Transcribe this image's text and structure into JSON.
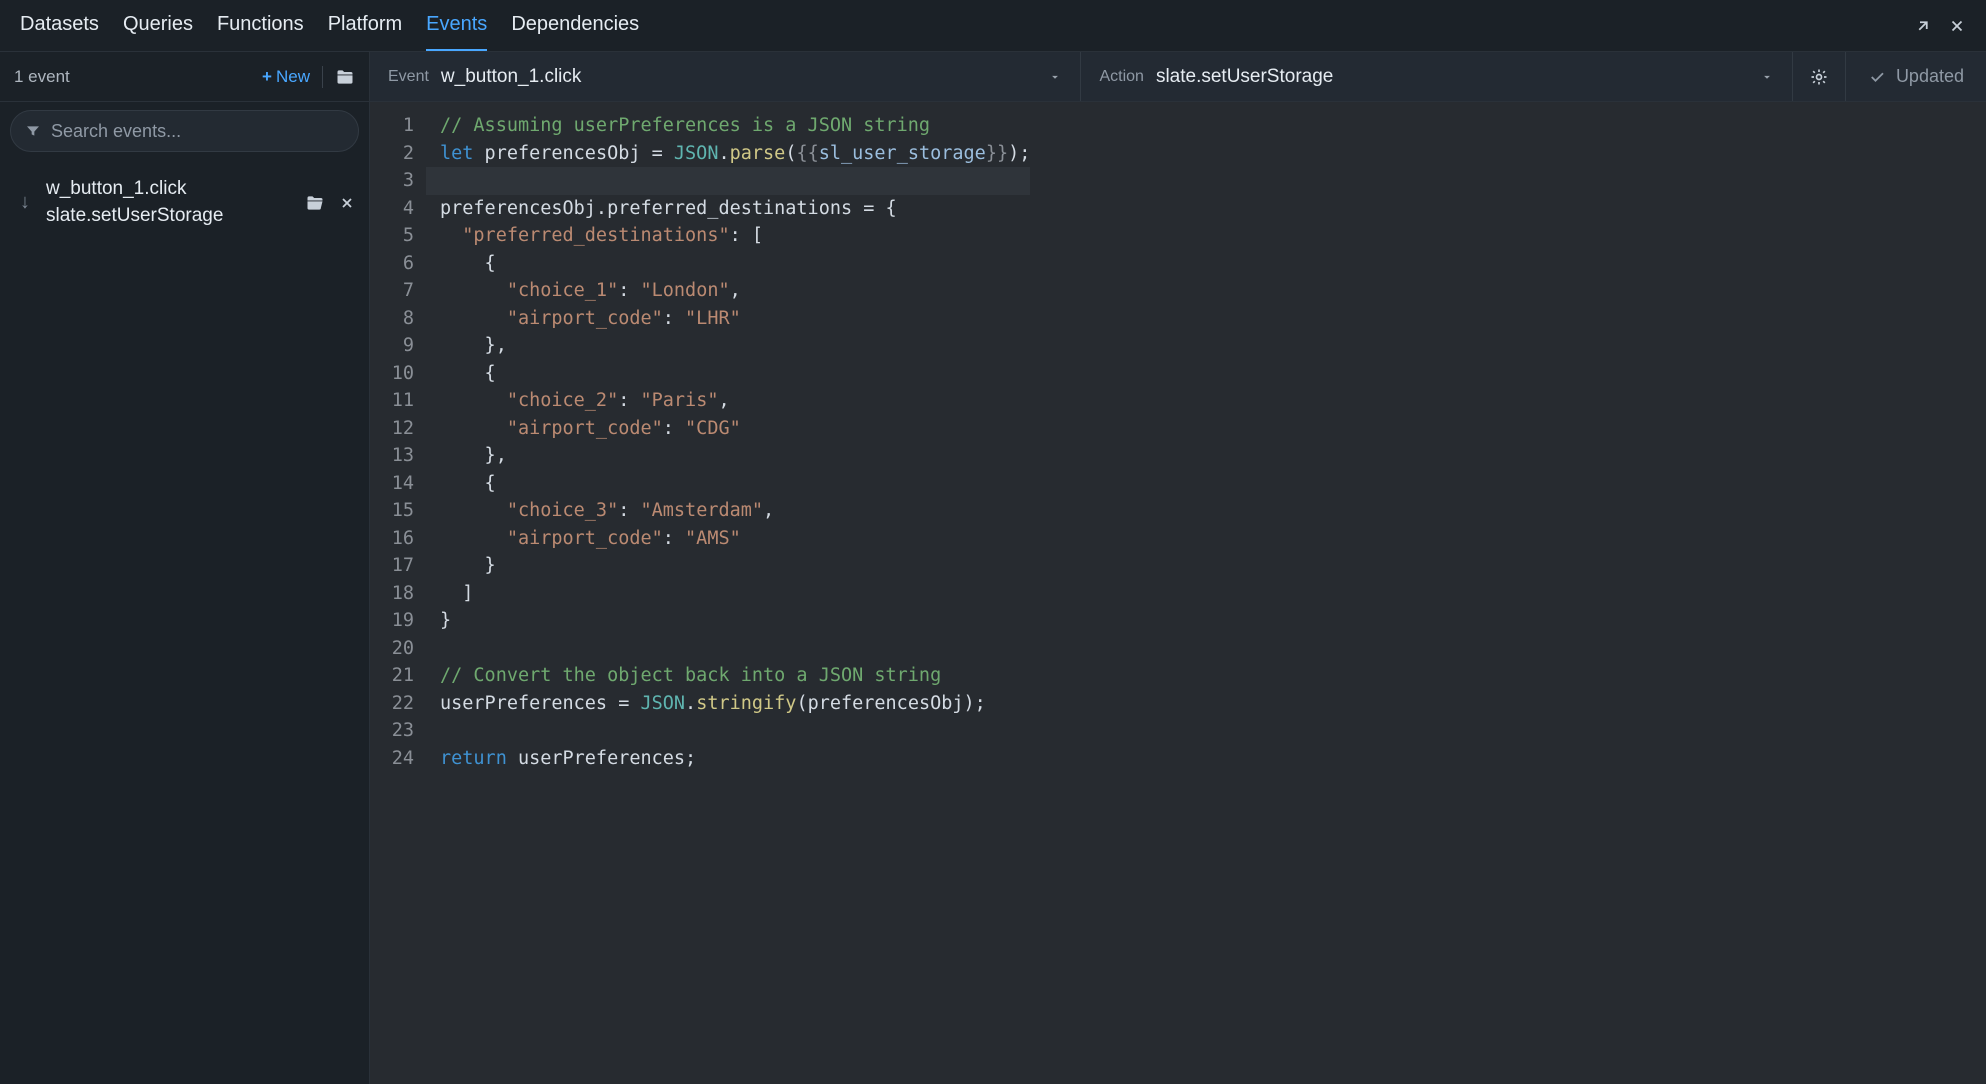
{
  "tabs": {
    "items": [
      "Datasets",
      "Queries",
      "Functions",
      "Platform",
      "Events",
      "Dependencies"
    ],
    "active_index": 4
  },
  "sidebar": {
    "count_label": "1 event",
    "new_label": "New",
    "search_placeholder": "Search events...",
    "items": [
      {
        "title": "w_button_1.click",
        "subtitle": "slate.setUserStorage"
      }
    ]
  },
  "editor_header": {
    "event_label": "Event",
    "event_value": "w_button_1.click",
    "action_label": "Action",
    "action_value": "slate.setUserStorage",
    "status": "Updated"
  },
  "code": {
    "highlight_line": 3,
    "lines": [
      [
        [
          "cmt",
          "// Assuming userPreferences is a JSON string"
        ]
      ],
      [
        [
          "kw",
          "let"
        ],
        [
          "pun",
          " preferencesObj = "
        ],
        [
          "cls",
          "JSON"
        ],
        [
          "pun",
          "."
        ],
        [
          "fn",
          "parse"
        ],
        [
          "pun",
          "("
        ],
        [
          "tpl",
          "{{"
        ],
        [
          "id",
          "sl_user_storage"
        ],
        [
          "tpl",
          "}}"
        ],
        [
          "pun",
          ");"
        ]
      ],
      [],
      [
        [
          "pun",
          "preferencesObj.preferred_destinations = {"
        ]
      ],
      [
        [
          "pun",
          "  "
        ],
        [
          "str",
          "\"preferred_destinations\""
        ],
        [
          "pun",
          ": ["
        ]
      ],
      [
        [
          "pun",
          "    {"
        ]
      ],
      [
        [
          "pun",
          "      "
        ],
        [
          "str",
          "\"choice_1\""
        ],
        [
          "pun",
          ": "
        ],
        [
          "str",
          "\"London\""
        ],
        [
          "pun",
          ","
        ]
      ],
      [
        [
          "pun",
          "      "
        ],
        [
          "str",
          "\"airport_code\""
        ],
        [
          "pun",
          ": "
        ],
        [
          "str",
          "\"LHR\""
        ]
      ],
      [
        [
          "pun",
          "    },"
        ]
      ],
      [
        [
          "pun",
          "    {"
        ]
      ],
      [
        [
          "pun",
          "      "
        ],
        [
          "str",
          "\"choice_2\""
        ],
        [
          "pun",
          ": "
        ],
        [
          "str",
          "\"Paris\""
        ],
        [
          "pun",
          ","
        ]
      ],
      [
        [
          "pun",
          "      "
        ],
        [
          "str",
          "\"airport_code\""
        ],
        [
          "pun",
          ": "
        ],
        [
          "str",
          "\"CDG\""
        ]
      ],
      [
        [
          "pun",
          "    },"
        ]
      ],
      [
        [
          "pun",
          "    {"
        ]
      ],
      [
        [
          "pun",
          "      "
        ],
        [
          "str",
          "\"choice_3\""
        ],
        [
          "pun",
          ": "
        ],
        [
          "str",
          "\"Amsterdam\""
        ],
        [
          "pun",
          ","
        ]
      ],
      [
        [
          "pun",
          "      "
        ],
        [
          "str",
          "\"airport_code\""
        ],
        [
          "pun",
          ": "
        ],
        [
          "str",
          "\"AMS\""
        ]
      ],
      [
        [
          "pun",
          "    }"
        ]
      ],
      [
        [
          "pun",
          "  ]"
        ]
      ],
      [
        [
          "pun",
          "}"
        ]
      ],
      [],
      [
        [
          "cmt",
          "// Convert the object back into a JSON string"
        ]
      ],
      [
        [
          "pun",
          "userPreferences = "
        ],
        [
          "cls",
          "JSON"
        ],
        [
          "pun",
          "."
        ],
        [
          "fn",
          "stringify"
        ],
        [
          "pun",
          "(preferencesObj);"
        ]
      ],
      [],
      [
        [
          "kw",
          "return"
        ],
        [
          "pun",
          " userPreferences;"
        ]
      ]
    ]
  }
}
